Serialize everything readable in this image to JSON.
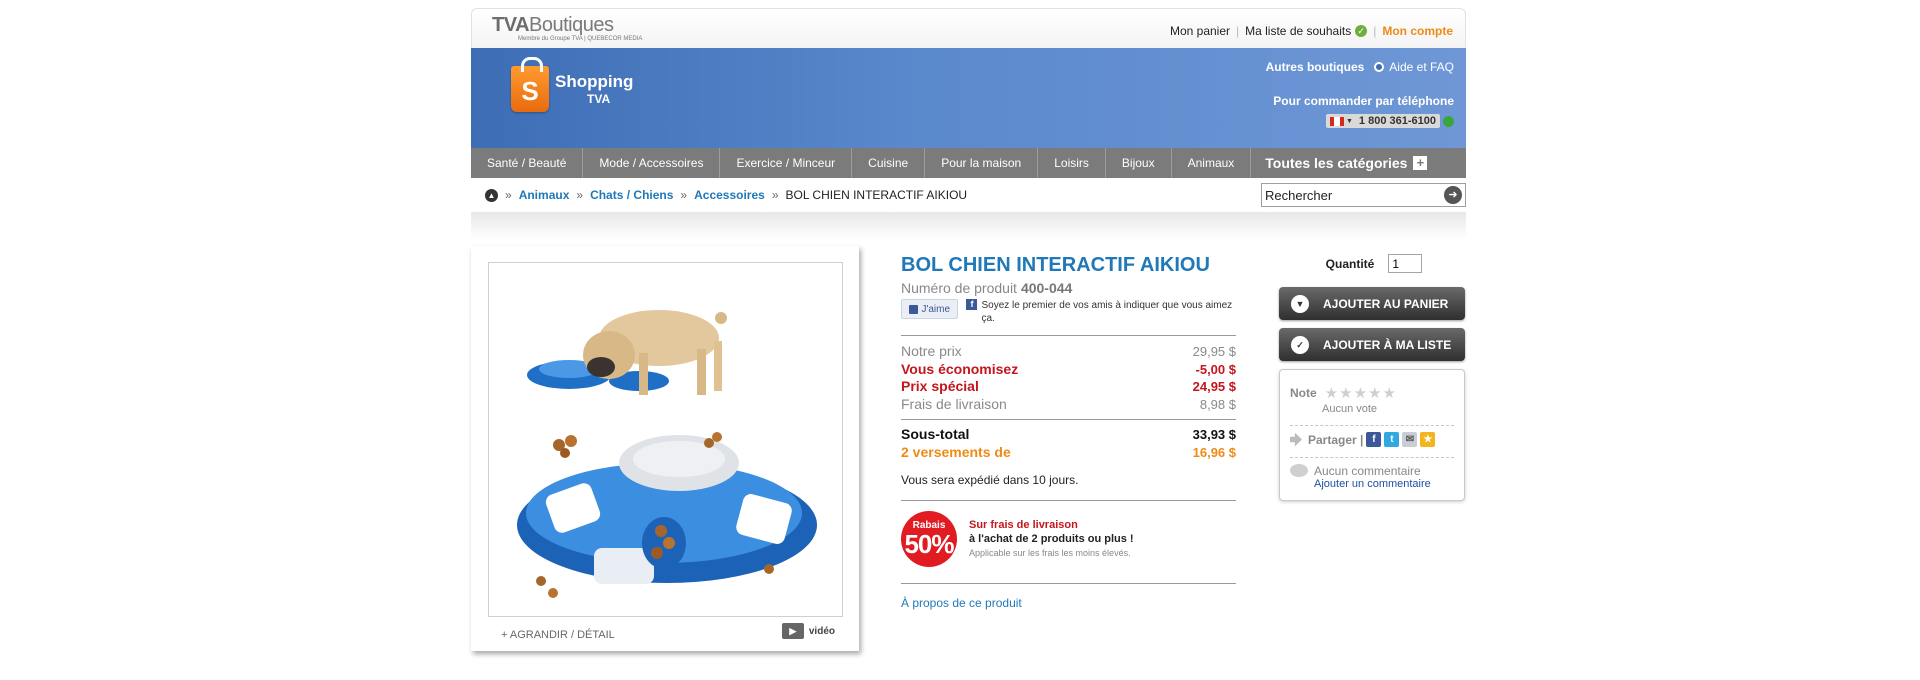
{
  "header": {
    "logo_main": "TVA",
    "logo_boutiques": "Boutiques",
    "logo_sub": "Membre du Groupe TVA | QUEBECOR MEDIA",
    "links": {
      "cart": "Mon panier",
      "wishlist": "Ma liste de souhaits",
      "account": "Mon compte"
    }
  },
  "banner": {
    "logo_shopping": "Shopping",
    "logo_tva": "TVA",
    "other_shops": "Autres boutiques",
    "help": "Aide et FAQ",
    "order_label": "Pour commander par téléphone",
    "phone": "1 800 361-6100"
  },
  "nav": {
    "items": [
      "Santé / Beauté",
      "Mode / Accessoires",
      "Exercice / Minceur",
      "Cuisine",
      "Pour la maison",
      "Loisirs",
      "Bijoux",
      "Animaux"
    ],
    "all_categories": "Toutes les catégories"
  },
  "breadcrumb": {
    "items": [
      "Animaux",
      "Chats / Chiens",
      "Accessoires"
    ],
    "current": "BOL CHIEN INTERACTIF AIKIOU"
  },
  "search": {
    "value": "Rechercher"
  },
  "product": {
    "title": "BOL CHIEN INTERACTIF AIKIOU",
    "sku_label": "Numéro de produit",
    "sku": "400-044",
    "like_label": "J'aime",
    "fb_text": "Soyez le premier de vos amis à indiquer que vous aimez ça.",
    "enlarge": "+ AGRANDIR / DÉTAIL",
    "video": "vidéo",
    "prices": {
      "our_price_label": "Notre prix",
      "our_price": "29,95 $",
      "savings_label": "Vous économisez",
      "savings": "-5,00 $",
      "special_label": "Prix spécial",
      "special": "24,95 $",
      "shipping_label": "Frais de livraison",
      "shipping": "8,98 $",
      "subtotal_label": "Sous-total",
      "subtotal": "33,93 $",
      "installments_label": "2 versements de",
      "installments": "16,96 $"
    },
    "ship_note": "Vous sera expédié dans 10 jours.",
    "promo": {
      "badge_top": "Rabais",
      "badge_pct": "50%",
      "line1": "Sur frais de livraison",
      "line2": "à l'achat de 2 produits ou plus !",
      "line3": "Applicable sur les frais les moins élevés."
    },
    "about": "À propos de ce produit"
  },
  "buy": {
    "qty_label": "Quantité",
    "qty_value": "1",
    "add_cart": "AJOUTER AU PANIER",
    "add_list": "AJOUTER À MA LISTE",
    "note_label": "Note",
    "no_vote": "Aucun vote",
    "share_label": "Partager |",
    "no_comment": "Aucun commentaire",
    "add_comment": "Ajouter un commentaire"
  },
  "colors": {
    "banner_blue": "#4f7ec4",
    "link_blue": "#1f78b8",
    "price_red": "#c4161c",
    "accent_orange": "#f08a16",
    "nav_grey": "#7b7b7b"
  }
}
